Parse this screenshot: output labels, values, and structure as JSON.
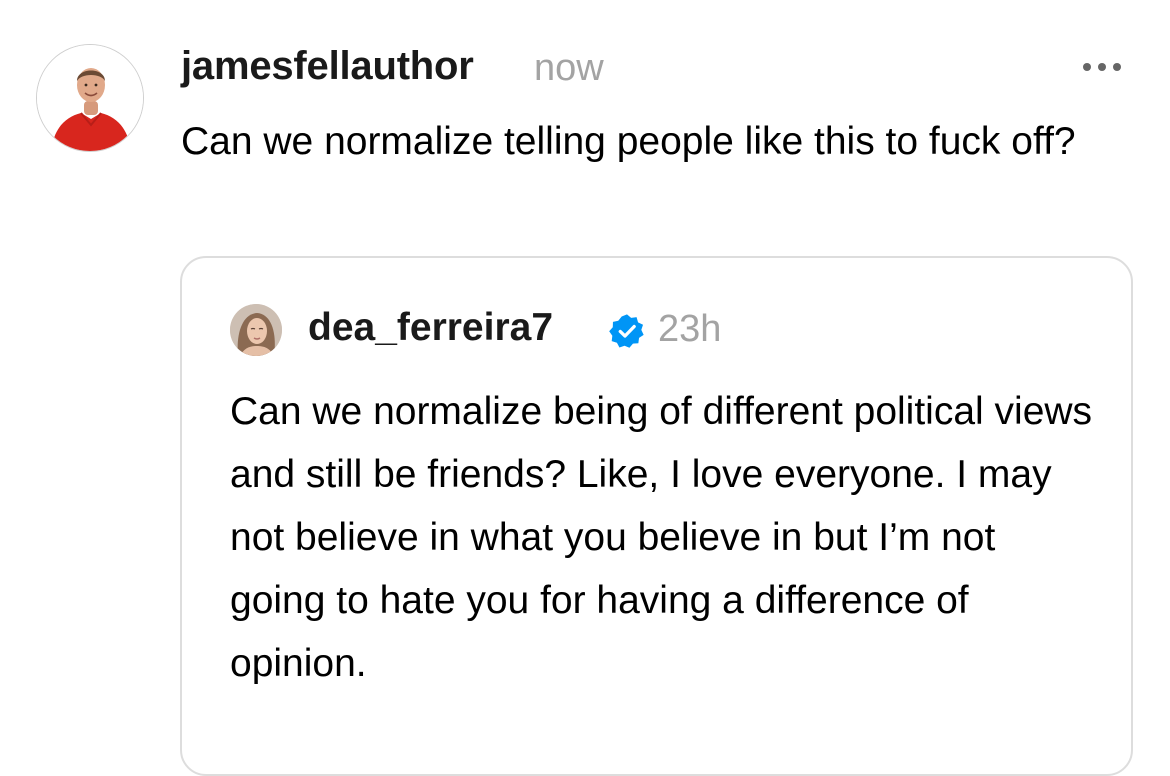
{
  "post": {
    "author": {
      "username": "jamesfellauthor",
      "avatar_icon": "profile-photo-man-red-shirt"
    },
    "timestamp": "now",
    "menu_icon": "more-horizontal-icon",
    "text": "Can we normalize telling people like this to fuck off?"
  },
  "quoted_post": {
    "author": {
      "username": "dea_ferreira7",
      "verified": true,
      "avatar_icon": "profile-photo-woman"
    },
    "timestamp": "23h",
    "text": "Can we normalize being of different political views and still be friends? Like, I love everyone. I may not believe in what you believe in but I’m not going to hate you for having a difference of opinion."
  },
  "colors": {
    "text": "#000000",
    "muted": "#a3a3a3",
    "card_border": "#dddddd",
    "verified_blue": "#0095f6"
  }
}
